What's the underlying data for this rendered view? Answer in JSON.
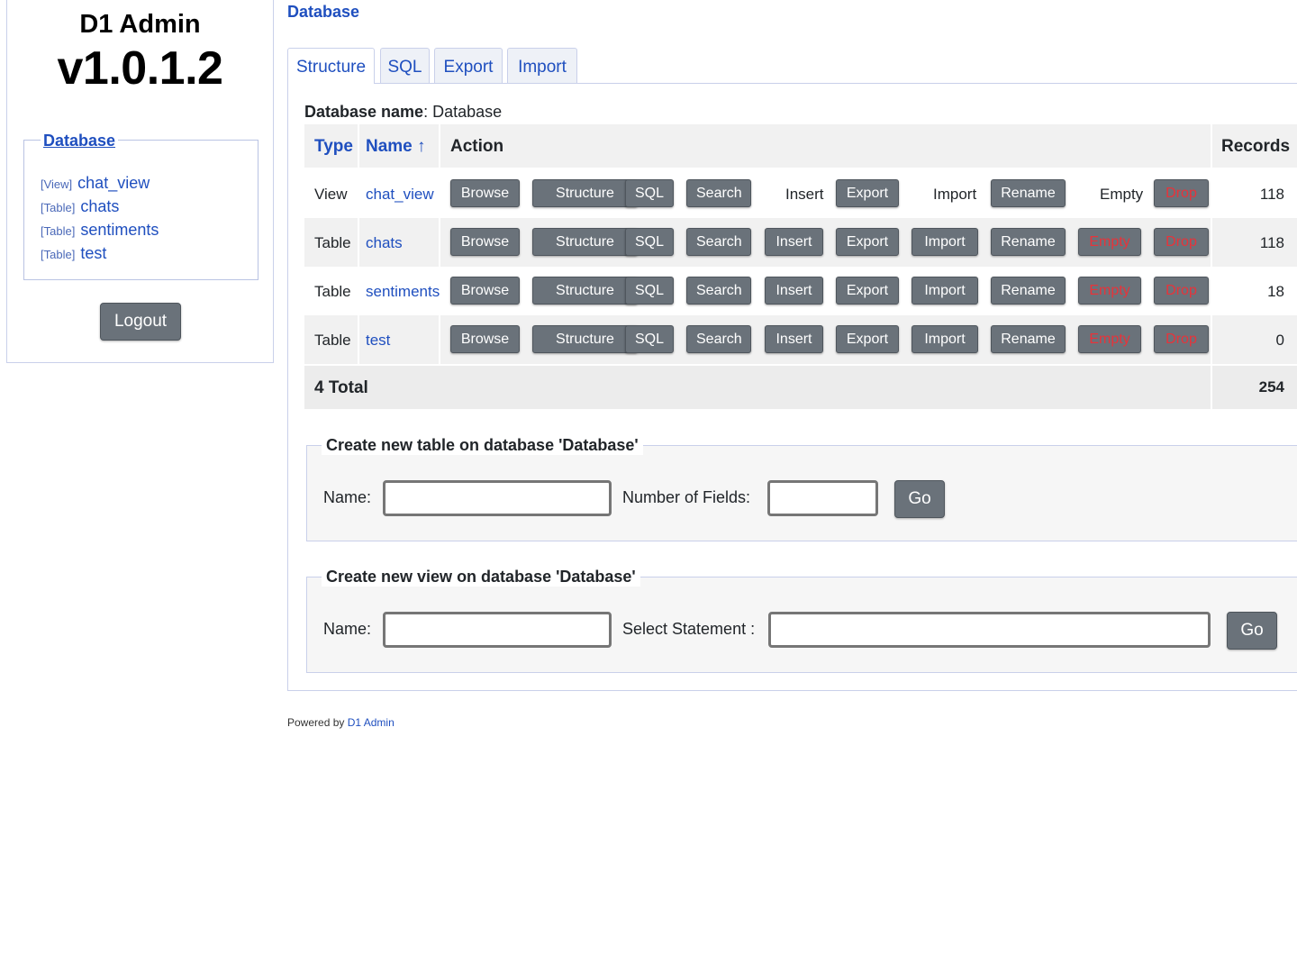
{
  "sidebar": {
    "app_title": "D1 Admin",
    "version": "v1.0.1.2",
    "database_label": "Database",
    "objects": [
      {
        "type": "[View]",
        "name": "chat_view"
      },
      {
        "type": "[Table]",
        "name": "chats"
      },
      {
        "type": "[Table]",
        "name": "sentiments"
      },
      {
        "type": "[Table]",
        "name": "test"
      }
    ],
    "logout_label": "Logout"
  },
  "page_heading": "Database",
  "tabs": [
    {
      "label": "Structure",
      "active": true
    },
    {
      "label": "SQL"
    },
    {
      "label": "Export"
    },
    {
      "label": "Import"
    }
  ],
  "db_name_label": "Database name",
  "db_name_value": "Database",
  "table": {
    "headers": {
      "type": "Type",
      "name": "Name ↑",
      "action": "Action",
      "records": "Records"
    },
    "rows": [
      {
        "type": "View",
        "name": "chat_view",
        "actions": {
          "browse": "Browse",
          "structure": "Structure",
          "sql": "SQL",
          "search": "Search",
          "insert": "Insert",
          "export": "Export",
          "import": "Import",
          "rename": "Rename",
          "empty": "Empty",
          "drop": "Drop"
        },
        "records": "118"
      },
      {
        "type": "Table",
        "name": "chats",
        "actions": {
          "browse": "Browse",
          "structure": "Structure",
          "sql": "SQL",
          "search": "Search",
          "insert": "Insert",
          "export": "Export",
          "import": "Import",
          "rename": "Rename",
          "empty": "Empty",
          "drop": "Drop"
        },
        "records": "118"
      },
      {
        "type": "Table",
        "name": "sentiments",
        "actions": {
          "browse": "Browse",
          "structure": "Structure",
          "sql": "SQL",
          "search": "Search",
          "insert": "Insert",
          "export": "Export",
          "import": "Import",
          "rename": "Rename",
          "empty": "Empty",
          "drop": "Drop"
        },
        "records": "18"
      },
      {
        "type": "Table",
        "name": "test",
        "actions": {
          "browse": "Browse",
          "structure": "Structure",
          "sql": "SQL",
          "search": "Search",
          "insert": "Insert",
          "export": "Export",
          "import": "Import",
          "rename": "Rename",
          "empty": "Empty",
          "drop": "Drop"
        },
        "records": "0"
      }
    ],
    "total_label": "4 Total",
    "total_records": "254"
  },
  "create_table": {
    "legend": "Create new table on database 'Database'",
    "name_label": "Name:",
    "name_value": "",
    "fields_label": "Number of Fields:",
    "fields_value": "",
    "go_label": "Go"
  },
  "create_view": {
    "legend": "Create new view on database 'Database'",
    "name_label": "Name:",
    "name_value": "",
    "select_label": "Select Statement :",
    "select_value": "",
    "go_label": "Go"
  },
  "footer": {
    "prefix": "Powered by",
    "link": "D1 Admin"
  },
  "colors": {
    "link": "#1f4fbf",
    "button": "#6a727a",
    "danger_text": "#e8333a",
    "row_shade": "#f1f1f1"
  }
}
